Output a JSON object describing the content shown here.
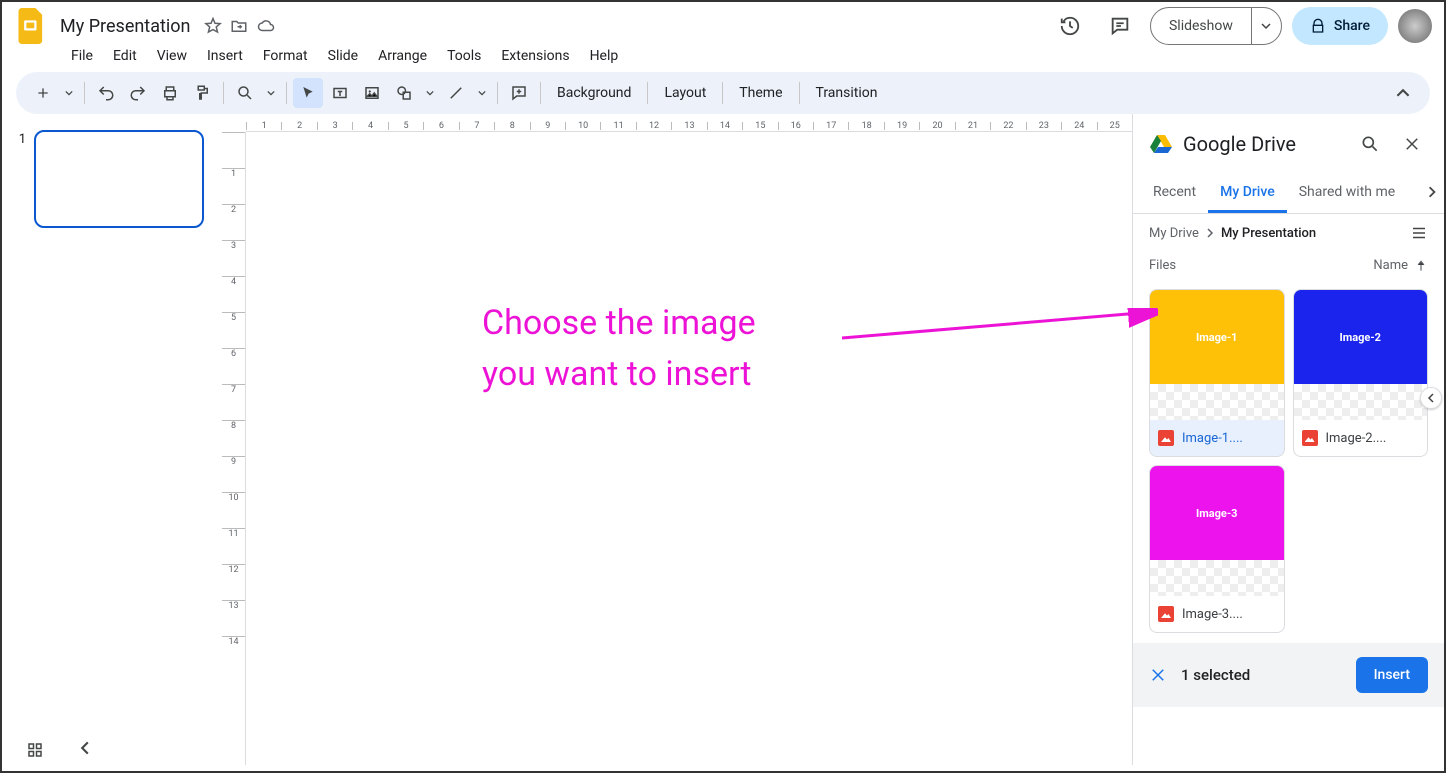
{
  "doc": {
    "title": "My Presentation"
  },
  "menubar": [
    "File",
    "Edit",
    "View",
    "Insert",
    "Format",
    "Slide",
    "Arrange",
    "Tools",
    "Extensions",
    "Help"
  ],
  "header_buttons": {
    "slideshow": "Slideshow",
    "share": "Share"
  },
  "toolbar_text": {
    "background": "Background",
    "layout": "Layout",
    "theme": "Theme",
    "transition": "Transition"
  },
  "slide_number": "1",
  "annotation": {
    "line1": "Choose the image",
    "line2": "you want to insert"
  },
  "sidepanel": {
    "title": "Google Drive",
    "tabs": [
      "Recent",
      "My Drive",
      "Shared with me"
    ],
    "active_tab": 1,
    "breadcrumb": {
      "root": "My Drive",
      "current": "My Presentation"
    },
    "list_header": {
      "left": "Files",
      "sort": "Name"
    },
    "files": [
      {
        "label": "Image-1",
        "name": "Image-1....",
        "color": "#ffc107",
        "selected": true
      },
      {
        "label": "Image-2",
        "name": "Image-2....",
        "color": "#1a24ec",
        "selected": false
      },
      {
        "label": "Image-3",
        "name": "Image-3....",
        "color": "#ec13ec",
        "selected": false
      }
    ],
    "footer": {
      "count": "1 selected",
      "button": "Insert"
    }
  },
  "ruler_h": [
    "1",
    "2",
    "3",
    "4",
    "5",
    "6",
    "7",
    "8",
    "9",
    "10",
    "11",
    "12",
    "13",
    "14",
    "15",
    "16",
    "17",
    "18",
    "19",
    "20",
    "21",
    "22",
    "23",
    "24",
    "25"
  ],
  "ruler_v": [
    "",
    "1",
    "2",
    "3",
    "4",
    "5",
    "6",
    "7",
    "8",
    "9",
    "10",
    "11",
    "12",
    "13",
    "14"
  ]
}
